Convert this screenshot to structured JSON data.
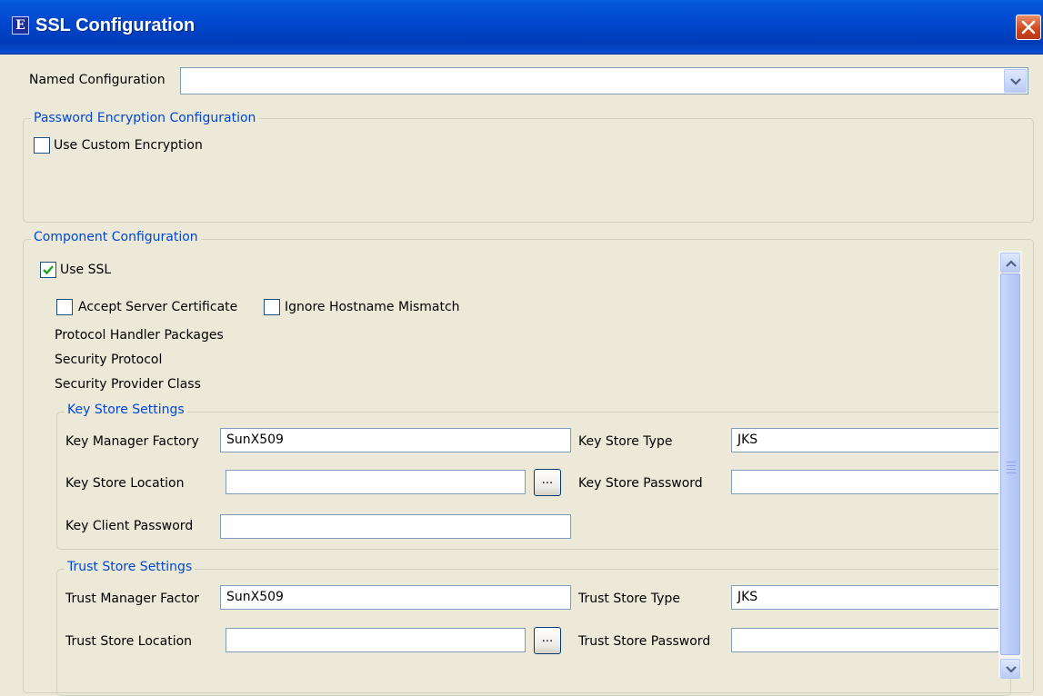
{
  "window": {
    "title": "SSL Configuration",
    "icon_letter": "E"
  },
  "named_config": {
    "label": "Named Configuration",
    "value": ""
  },
  "password_encryption": {
    "legend": "Password Encryption Configuration",
    "use_custom_encryption": {
      "label": "Use Custom Encryption",
      "checked": false
    }
  },
  "component": {
    "legend": "Component Configuration",
    "use_ssl": {
      "label": "Use SSL",
      "checked": true
    },
    "accept_server_cert": {
      "label": "Accept Server Certificate",
      "checked": false
    },
    "ignore_hostname": {
      "label": "Ignore Hostname Mismatch",
      "checked": false
    },
    "protocol_handler_packages": "Protocol Handler Packages",
    "security_protocol": "Security Protocol",
    "security_provider_class": "Security Provider Class"
  },
  "key_store": {
    "legend": "Key Store Settings",
    "manager_factory_label": "Key Manager Factory",
    "manager_factory_value": "SunX509",
    "store_type_label": "Key Store Type",
    "store_type_value": "JKS",
    "location_label": "Key Store Location",
    "location_value": "",
    "browse_label": "...",
    "password_label": "Key Store Password",
    "password_value": "",
    "client_password_label": "Key Client Password",
    "client_password_value": ""
  },
  "trust_store": {
    "legend": "Trust Store Settings",
    "manager_factory_label": "Trust Manager Factor",
    "manager_factory_value": "SunX509",
    "store_type_label": "Trust Store Type",
    "store_type_value": "JKS",
    "location_label": "Trust Store Location",
    "location_value": "",
    "browse_label": "...",
    "password_label": "Trust Store Password",
    "password_value": ""
  },
  "colors": {
    "window_bg": "#ECE9D8",
    "titlebar": "#0046CC",
    "legend_text": "#0046D5",
    "checkmark": "#21A121"
  }
}
